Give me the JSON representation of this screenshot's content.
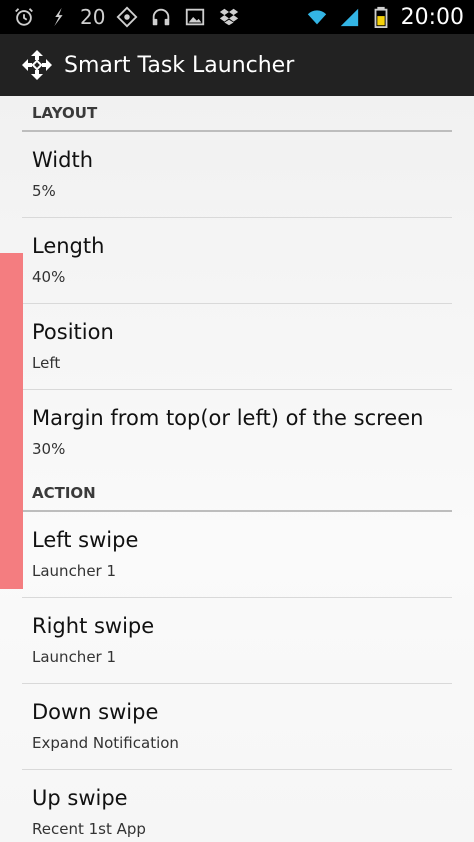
{
  "status_bar": {
    "notification_count": "20",
    "time": "20:00",
    "icons": [
      "alarm-icon",
      "lightning-icon",
      "app-icon",
      "headphones-icon",
      "image-icon",
      "dropbox-icon",
      "wifi-icon",
      "signal-icon",
      "battery-icon"
    ]
  },
  "action_bar": {
    "title": "Smart Task Launcher",
    "icon": "move-arrows-icon"
  },
  "sections": {
    "layout": {
      "header": "LAYOUT",
      "items": [
        {
          "title": "Width",
          "summary": "5%"
        },
        {
          "title": "Length",
          "summary": "40%"
        },
        {
          "title": "Position",
          "summary": "Left"
        },
        {
          "title": "Margin from top(or left) of the screen",
          "summary": "30%"
        }
      ]
    },
    "action": {
      "header": "ACTION",
      "items": [
        {
          "title": "Left swipe",
          "summary": "Launcher 1"
        },
        {
          "title": "Right swipe",
          "summary": "Launcher 1"
        },
        {
          "title": "Down swipe",
          "summary": "Expand Notification"
        },
        {
          "title": "Up swipe",
          "summary": "Recent 1st App"
        }
      ]
    }
  },
  "colors": {
    "status_bar_bg": "#000000",
    "action_bar_bg": "#222222",
    "edge_handle": "#f47d80",
    "wifi_accent": "#33b5e5",
    "battery": "#f5d20a"
  }
}
